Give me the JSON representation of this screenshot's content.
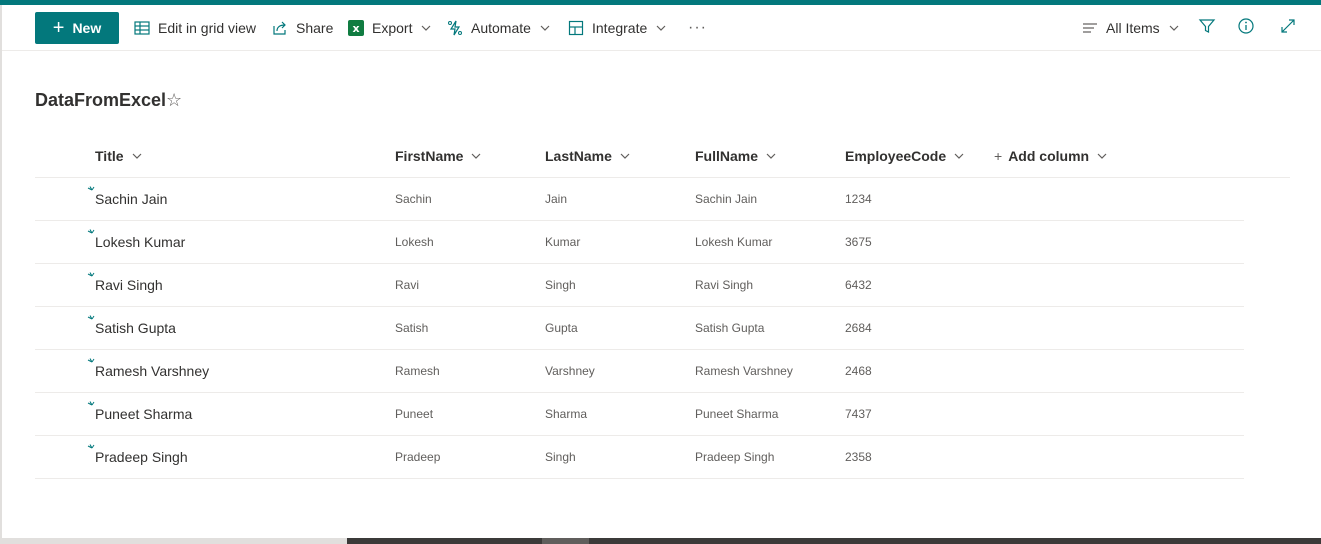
{
  "toolbar": {
    "new_label": "New",
    "edit_grid_label": "Edit in grid view",
    "share_label": "Share",
    "export_label": "Export",
    "automate_label": "Automate",
    "integrate_label": "Integrate",
    "more_label": "···",
    "view_label": "All Items",
    "icons": [
      "plus-icon",
      "grid-icon",
      "share-icon",
      "excel-icon",
      "automate-icon",
      "integrate-icon",
      "filter-icon",
      "info-icon",
      "expand-icon"
    ]
  },
  "list": {
    "title": "DataFromExcel",
    "favorite_icon": "☆"
  },
  "columns": [
    "Title",
    "FirstName",
    "LastName",
    "FullName",
    "EmployeeCode"
  ],
  "add_column_label": "Add column",
  "rows": [
    {
      "title": "Sachin Jain",
      "first": "Sachin",
      "last": "Jain",
      "full": "Sachin Jain",
      "code": "1234"
    },
    {
      "title": "Lokesh Kumar",
      "first": "Lokesh",
      "last": "Kumar",
      "full": "Lokesh Kumar",
      "code": "3675"
    },
    {
      "title": "Ravi Singh",
      "first": "Ravi",
      "last": "Singh",
      "full": "Ravi Singh",
      "code": "6432"
    },
    {
      "title": "Satish Gupta",
      "first": "Satish",
      "last": "Gupta",
      "full": "Satish Gupta",
      "code": "2684"
    },
    {
      "title": "Ramesh Varshney",
      "first": "Ramesh",
      "last": "Varshney",
      "full": "Ramesh Varshney",
      "code": "2468"
    },
    {
      "title": "Puneet Sharma",
      "first": "Puneet",
      "last": "Sharma",
      "full": "Puneet Sharma",
      "code": "7437"
    },
    {
      "title": "Pradeep Singh",
      "first": "Pradeep",
      "last": "Singh",
      "full": "Pradeep Singh",
      "code": "2358"
    }
  ],
  "colors": {
    "accent": "#03787c",
    "excel": "#107c41",
    "text": "#323130",
    "secondary_text": "#605e5c",
    "divider": "#edebe9"
  }
}
